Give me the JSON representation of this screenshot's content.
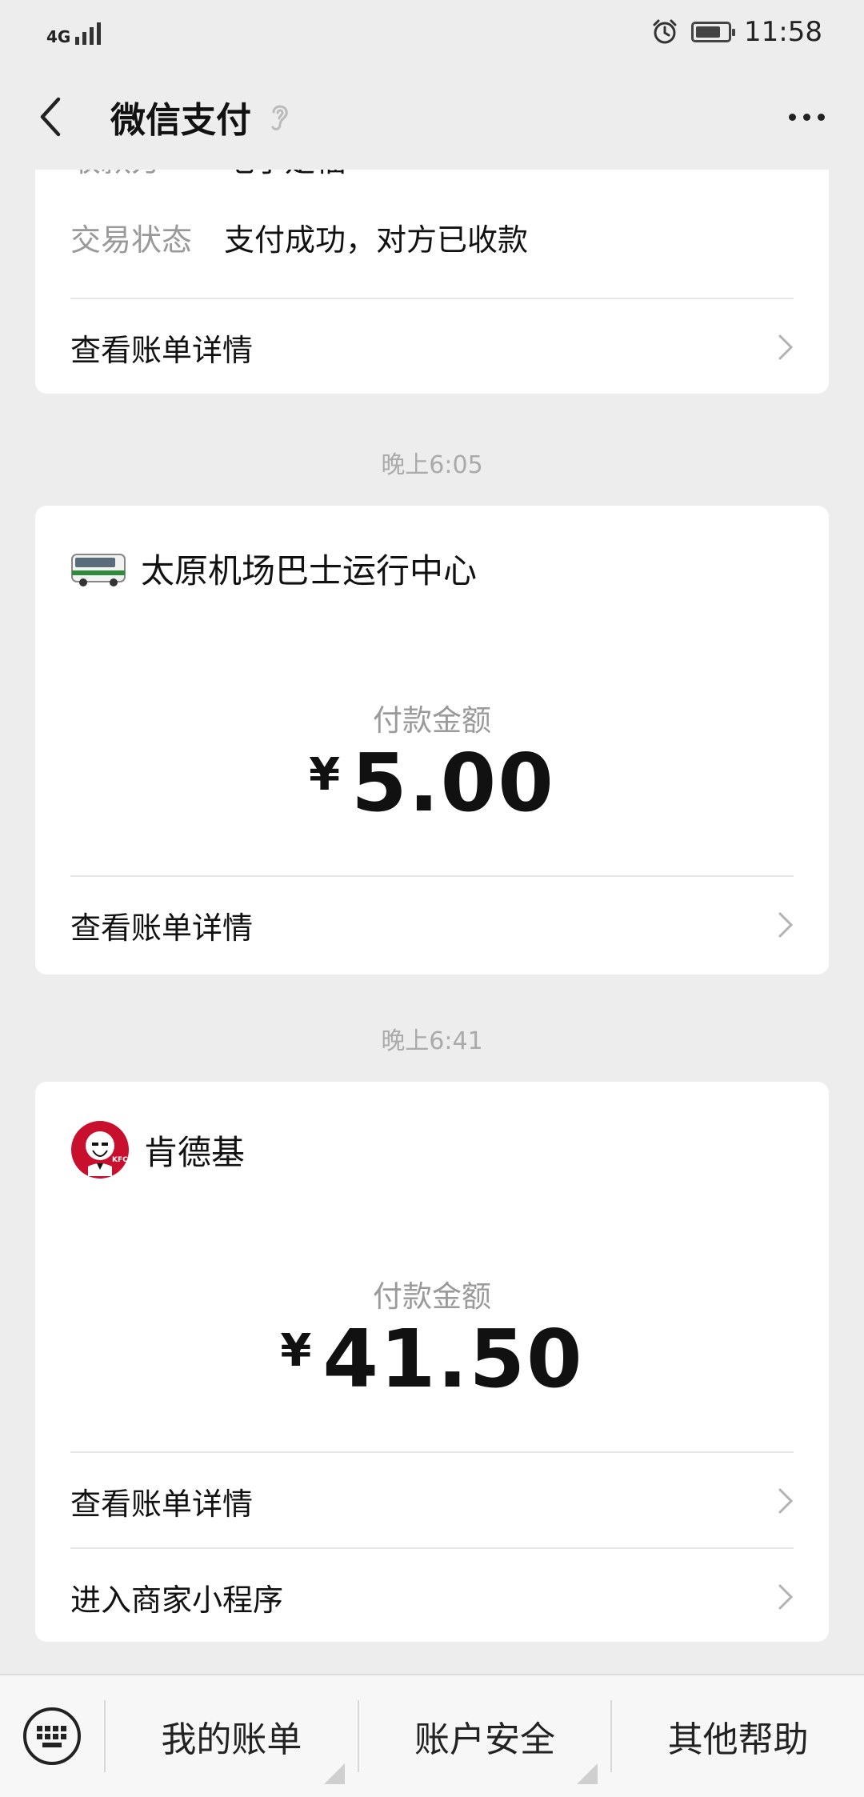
{
  "status_bar": {
    "network": "4G",
    "time": "11:58"
  },
  "nav": {
    "title": "微信支付"
  },
  "top_card": {
    "partial_key": "收款方",
    "partial_value": "吃了是福",
    "status_key": "交易状态",
    "status_value": "支付成功，对方已收款",
    "link_label": "查看账单详情"
  },
  "transactions": [
    {
      "time": "晚上6:05",
      "merchant": "太原机场巴士运行中心",
      "merchant_icon": "bus-icon",
      "amount_label": "付款金额",
      "currency": "¥",
      "amount": "5.00",
      "link_label": "查看账单详情"
    },
    {
      "time": "晚上6:41",
      "merchant": "肯德基",
      "merchant_icon": "kfc-logo-icon",
      "amount_label": "付款金额",
      "currency": "¥",
      "amount": "41.50",
      "link_label": "查看账单详情",
      "link2_label": "进入商家小程序"
    }
  ],
  "tabbar": {
    "items": [
      "我的账单",
      "账户安全",
      "其他帮助"
    ]
  }
}
